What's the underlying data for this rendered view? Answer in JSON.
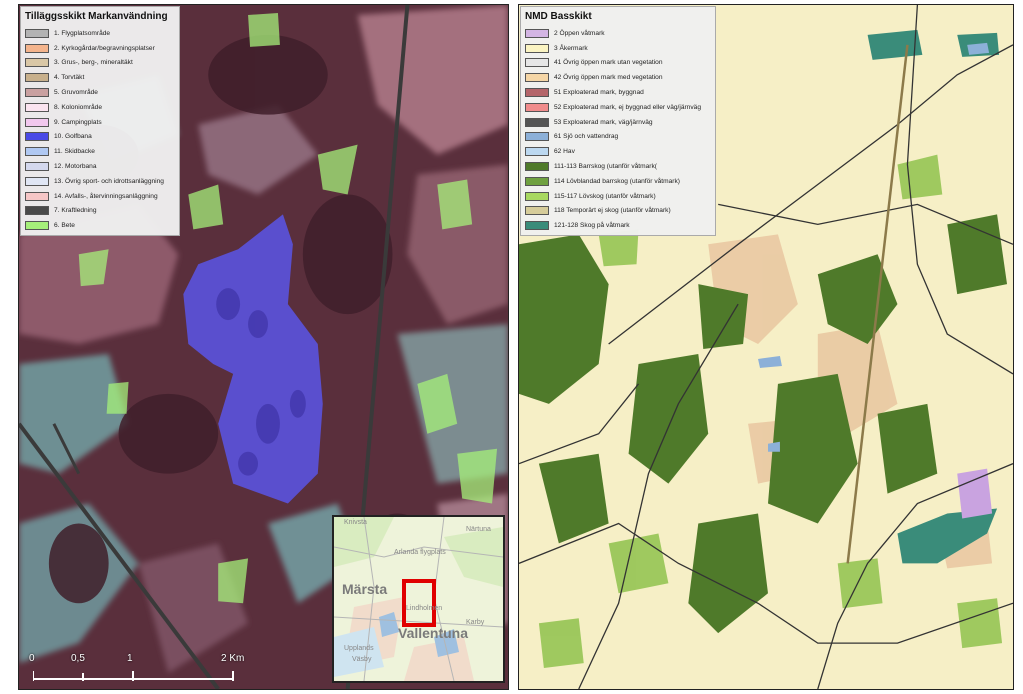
{
  "left_map": {
    "legend": {
      "title": "Tilläggsskikt Markanvändning",
      "items": [
        {
          "label": "1. Flygplatsområde",
          "color": "#b3b3b3"
        },
        {
          "label": "2. Kyrkogårdar/begravningsplatser",
          "color": "#f4b48c"
        },
        {
          "label": "3. Grus-, berg-, mineraltäkt",
          "color": "#d9c7a6"
        },
        {
          "label": "4. Torvtäkt",
          "color": "#c8b08c"
        },
        {
          "label": "5. Gruvområde",
          "color": "#c9a0a0"
        },
        {
          "label": "8. Koloniområde",
          "color": "#fbe4f0"
        },
        {
          "label": "9. Campingplats",
          "color": "#f2c8ee"
        },
        {
          "label": "10. Golfbana",
          "color": "#4a4ae6"
        },
        {
          "label": "11. Skidbacke",
          "color": "#b0c8f2"
        },
        {
          "label": "12. Motorbana",
          "color": "#d4d8ee"
        },
        {
          "label": "13. Övrig sport- och idrottsanläggning",
          "color": "#e0e6f4"
        },
        {
          "label": "14. Avfalls-, återvinningsanläggning",
          "color": "#f5c6c6"
        },
        {
          "label": "7. Kraftledning",
          "color": "#4a4a4a"
        },
        {
          "label": "6. Bete",
          "color": "#a6f07a"
        }
      ]
    },
    "inset": {
      "labels": {
        "knivsta": "Knivsta",
        "nartuna": "Närtuna",
        "arlanda": "Arlanda flygplats",
        "marsta": "Märsta",
        "lindholmen": "Lindholmen",
        "karby": "Karby",
        "vallentuna": "Vallentuna",
        "upplands": "Upplands",
        "vasby": "Väsby"
      }
    },
    "scale": {
      "t0": "0",
      "t1": "0,5",
      "t2": "1",
      "t3": "2 Km"
    }
  },
  "right_map": {
    "legend": {
      "title": "NMD Basskikt",
      "items": [
        {
          "label": "2 Öppen våtmark",
          "color": "#d3b5e3"
        },
        {
          "label": "3 Åkermark",
          "color": "#fbf4c2"
        },
        {
          "label": "41 Övrig öppen mark utan vegetation",
          "color": "#e6e6e6"
        },
        {
          "label": "42 Övrig öppen mark med vegetation",
          "color": "#f5d6a6"
        },
        {
          "label": "51 Exploaterad mark, byggnad",
          "color": "#b4656a"
        },
        {
          "label": "52 Exploaterad mark, ej byggnad eller väg/järnväg",
          "color": "#f08c8c"
        },
        {
          "label": "53 Exploaterad mark, väg/järnväg",
          "color": "#555555"
        },
        {
          "label": "61 Sjö och vattendrag",
          "color": "#8cb0d8"
        },
        {
          "label": "62 Hav",
          "color": "#bcd8f0"
        },
        {
          "label": "111-113 Barrskog (utanför våtmark(",
          "color": "#4f7a2a"
        },
        {
          "label": "114 Lövblandad barrskog (utanför våtmark)",
          "color": "#6fa040"
        },
        {
          "label": "115-117 Lövskog (utanför våtmark)",
          "color": "#a8d860"
        },
        {
          "label": "118 Temporärt ej skog (utanför våtmark)",
          "color": "#d6cc9a"
        },
        {
          "label": "121-128 Skog på våtmark",
          "color": "#3a8c7a"
        }
      ]
    }
  }
}
